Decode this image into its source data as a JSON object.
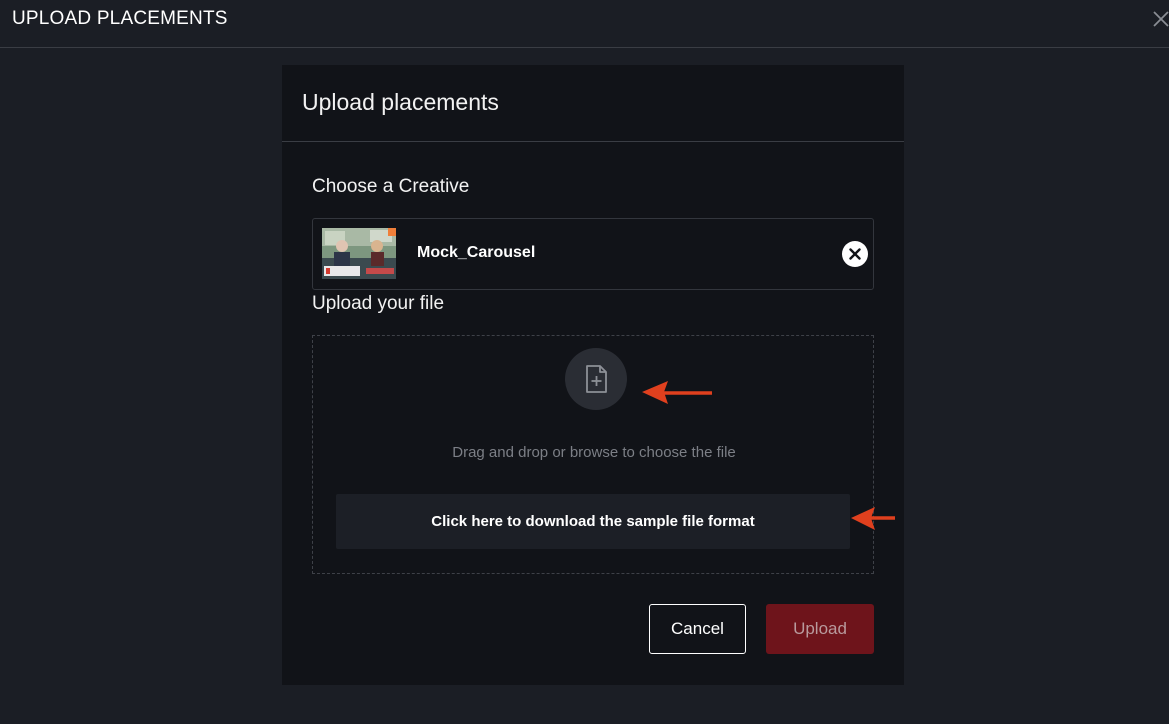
{
  "page": {
    "title": "UPLOAD PLACEMENTS",
    "close_icon": "close-icon"
  },
  "modal": {
    "title": "Upload placements",
    "creative_section": {
      "label": "Choose a Creative",
      "selected_creative": {
        "name": "Mock_Carousel",
        "thumbnail_icon": "creative-thumbnail",
        "remove_icon": "remove-circle-icon"
      }
    },
    "upload_section": {
      "label": "Upload your file",
      "file_icon": "file-plus-icon",
      "drop_text": "Drag and drop or browse to choose the file",
      "sample_button_label": "Click here to download the sample file format"
    },
    "actions": {
      "cancel_label": "Cancel",
      "upload_label": "Upload"
    }
  },
  "annotations": {
    "arrow_color": "#e0401e"
  },
  "colors": {
    "page_bg": "#1b1e25",
    "modal_bg": "#111318",
    "upload_button_bg": "#6e141b"
  }
}
